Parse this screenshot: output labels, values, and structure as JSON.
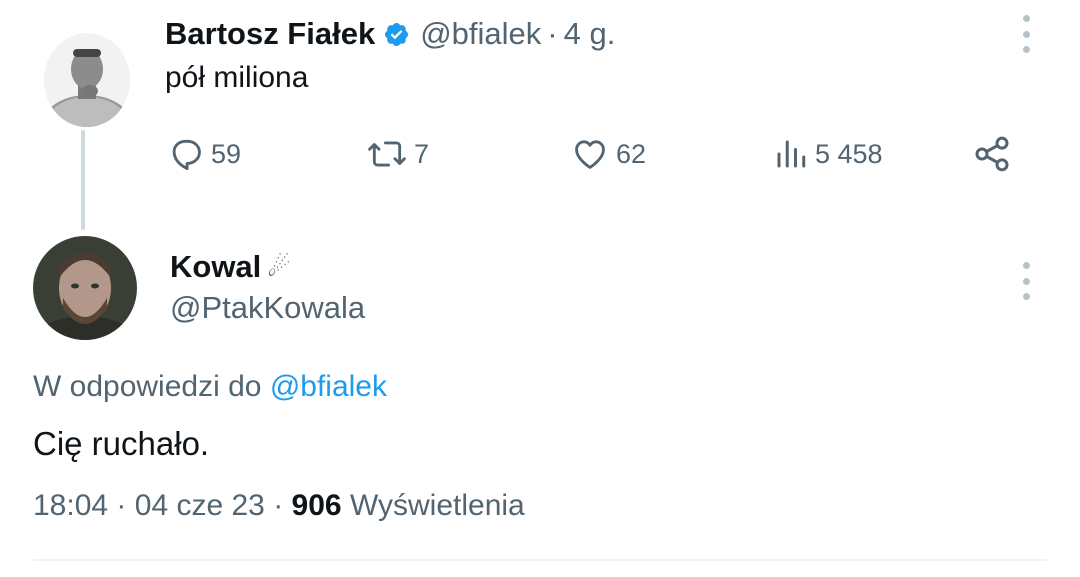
{
  "parent_tweet": {
    "author_name": "Bartosz Fiałek",
    "verified": true,
    "handle": "@bfialek",
    "separator": "·",
    "time": "4 g.",
    "text": "pół miliona",
    "actions": {
      "replies": "59",
      "retweets": "7",
      "likes": "62",
      "views": "5 458"
    },
    "icons": [
      "reply-icon",
      "retweet-icon",
      "like-icon",
      "views-icon",
      "share-icon",
      "more-icon"
    ]
  },
  "reply_tweet": {
    "author_name": "Kowal",
    "name_emoji": "☄",
    "handle": "@PtakKowala",
    "replying_prefix": "W odpowiedzi do",
    "replying_to": "@bfialek",
    "text": "Cię ruchało.",
    "time": "18:04",
    "sep1": "·",
    "date": "04 cze 23",
    "sep2": "·",
    "views_count": "906",
    "views_label": "Wyświetlenia"
  },
  "colors": {
    "text": "#0f1419",
    "secondary": "#536471",
    "accent": "#1d9bf0",
    "line": "#cfd9de"
  }
}
